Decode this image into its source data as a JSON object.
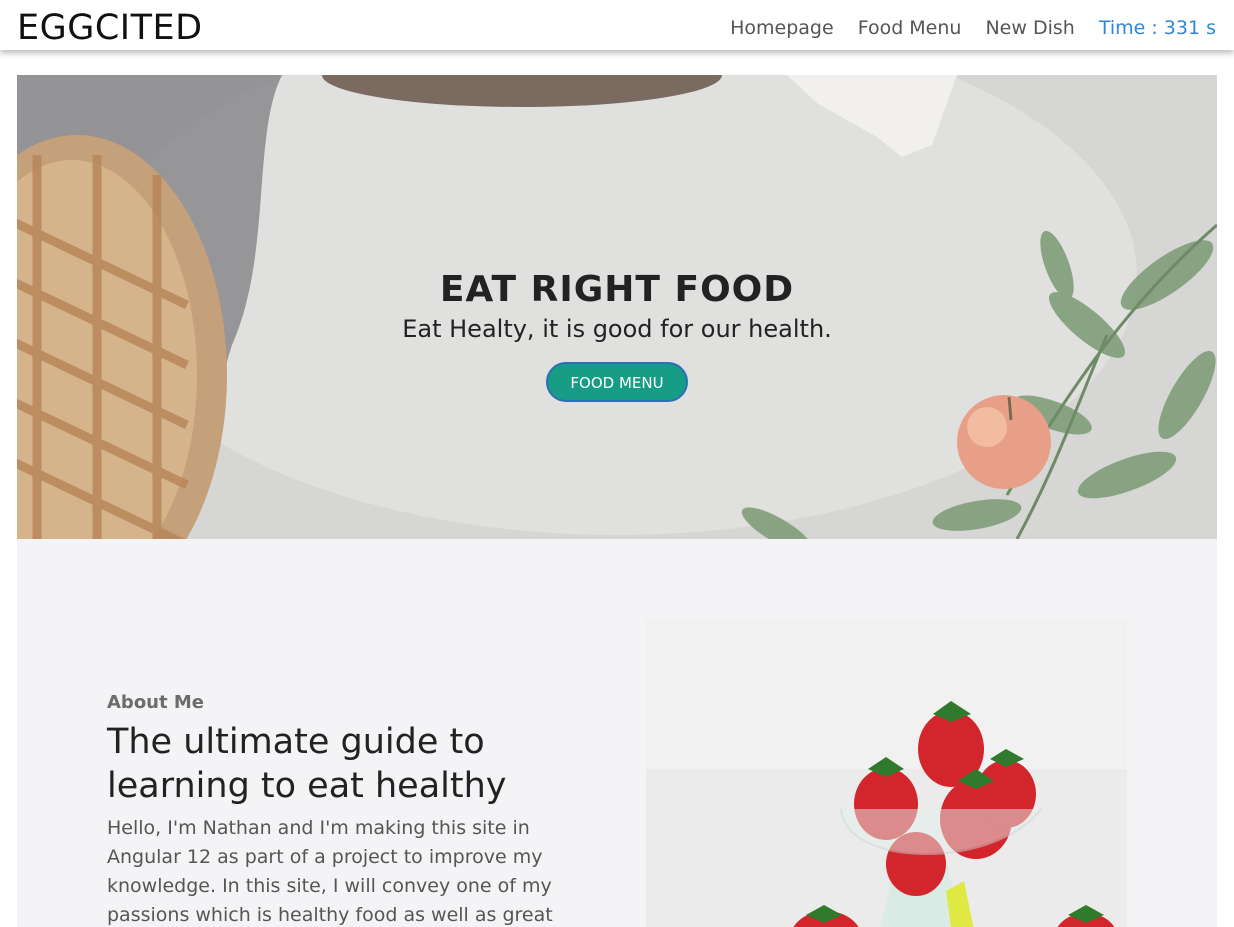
{
  "navbar": {
    "brand": "EGGCITED",
    "links": [
      "Homepage",
      "Food Menu",
      "New Dish"
    ],
    "time": "Time : 331 s"
  },
  "hero": {
    "title": "EAT RIGHT FOOD",
    "subtitle": "Eat Healty, it is good for our health.",
    "button_label": "FOOD MENU"
  },
  "about": {
    "label": "About Me",
    "heading": "The ultimate guide to learning to eat healthy",
    "body": "Hello, I'm Nathan and I'm making this site in Angular 12 as part of a project to improve my knowledge. In this site, I will convey one of my passions which is healthy food as well as great food."
  },
  "colors": {
    "accent": "#179c86",
    "time_link": "#2f87d8",
    "section_bg": "#f4f4f6"
  }
}
